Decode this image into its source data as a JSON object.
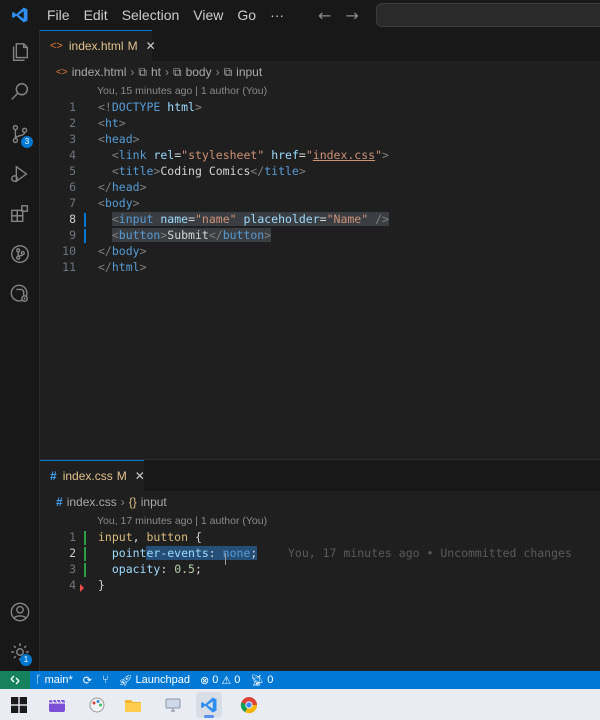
{
  "menu": [
    "File",
    "Edit",
    "Selection",
    "View",
    "Go",
    "···"
  ],
  "colors": {
    "accent": "#0078d4",
    "remote": "#16825d",
    "modified": "#e2c08d"
  },
  "activity_bar": {
    "items": [
      "explorer-icon",
      "search-icon",
      "source-control-icon",
      "run-debug-icon",
      "extensions-icon",
      "git-graph-icon",
      "remote-explorer-icon"
    ],
    "source_control_badge": "3",
    "settings_badge": "1",
    "bottom": [
      "account-icon",
      "manage-gear-icon"
    ]
  },
  "editor_top": {
    "tab": {
      "name": "index.html",
      "status": "M"
    },
    "breadcrumb": [
      "index.html",
      "ht",
      "body",
      "input"
    ],
    "blame": "You, 15 minutes ago | 1 author (You)",
    "lines": [
      {
        "n": "1",
        "code": "<!DOCTYPE html>"
      },
      {
        "n": "2",
        "code": "<ht>"
      },
      {
        "n": "3",
        "code": "<head>"
      },
      {
        "n": "4",
        "code": "  <link rel=\"stylesheet\" href=\"index.css\">"
      },
      {
        "n": "5",
        "code": "  <title>Coding Comics</title>"
      },
      {
        "n": "6",
        "code": "</head>"
      },
      {
        "n": "7",
        "code": "<body>"
      },
      {
        "n": "8",
        "code": "  <input name=\"name\" placeholder=\"Name\" />"
      },
      {
        "n": "9",
        "code": "  <button>Submit</button>"
      },
      {
        "n": "10",
        "code": "</body>"
      },
      {
        "n": "11",
        "code": "</html>"
      }
    ]
  },
  "editor_bottom": {
    "tab": {
      "name": "index.css",
      "status": "M"
    },
    "breadcrumb": [
      "index.css",
      "input"
    ],
    "blame": "You, 17 minutes ago | 1 author (You)",
    "inline_blame": "You, 17 minutes ago • Uncommitted changes",
    "lines": [
      {
        "n": "1",
        "code": "input, button {"
      },
      {
        "n": "2",
        "code": "  pointer-events: none;"
      },
      {
        "n": "3",
        "code": "  opacity: 0.5;"
      },
      {
        "n": "4",
        "code": "}"
      }
    ]
  },
  "status_bar": {
    "branch": "main*",
    "launchpad": "Launchpad",
    "errors": "0",
    "warnings": "0",
    "ports": "0"
  },
  "taskbar": [
    "windows-start-icon",
    "video-editor-icon",
    "paint-icon",
    "file-explorer-icon",
    "monitor-icon",
    "vscode-icon",
    "chrome-icon"
  ]
}
